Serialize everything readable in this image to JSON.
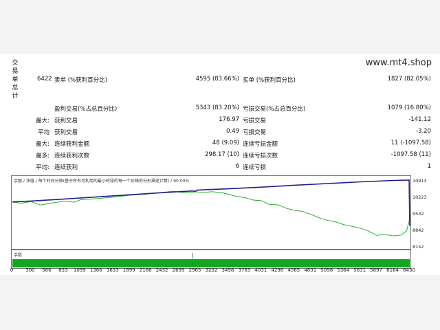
{
  "site": "www.mt4.shop",
  "side_label": [
    "交",
    "易",
    "单",
    "总",
    "计"
  ],
  "stats": {
    "total_trades": "6422",
    "short_label": "卖单 (%获利百分比)",
    "short_value": "4595 (83.66%)",
    "long_label": "买单 (%获利百分比)",
    "long_value": "1827 (82.05%)",
    "profit_trades_label": "盈利交易(%占总百分比)",
    "profit_trades_value": "5343 (83.20%)",
    "loss_trades_label": "亏损交易(%占总百分比)",
    "loss_trades_value": "1079 (16.80%)",
    "largest_prefix": "最大:",
    "largest_profit_label": "获利交易",
    "largest_profit_value": "176.97",
    "largest_loss_label": "亏损交易",
    "largest_loss_value": "-141.12",
    "average_prefix": "平均",
    "average_profit_label": "获利交易",
    "average_profit_value": "0.49",
    "average_loss_label": "亏损交易",
    "average_loss_value": "-3.20",
    "max_prefix": "最大:",
    "consec_wins_amount_label": "连续获利金额",
    "consec_wins_amount_value": "48 (9.09)",
    "consec_losses_amount_label": "连续亏损金额",
    "consec_losses_amount_value": "11 (-1097.58)",
    "most_prefix": "最多:",
    "consec_profit_count_label": "连续获利次数",
    "consec_profit_count_value": "298.17 (10)",
    "consec_loss_count_label": "连续亏损次数",
    "consec_loss_count_value": "-1097.58 (11)",
    "avg_prefix": "平均:",
    "avg_consec_wins_label": "连续获利",
    "avg_consec_wins_value": "6",
    "avg_consec_losses_label": "连续亏损",
    "avg_consec_losses_value": "1"
  },
  "chart_legend": "余额 / 净值 / 每个时间分格(基于所有可利用的最小时段的每一个价格的分形描述计算) / 90.00%",
  "volume_label": "手数",
  "colors": {
    "balance": "#1e1e8c",
    "equity": "#18a818",
    "volume": "#12a51f"
  },
  "chart_data": {
    "type": "line",
    "x_ticks": [
      "0",
      "300",
      "566",
      "833",
      "1099",
      "1366",
      "1633",
      "1899",
      "2166",
      "2432",
      "2699",
      "2965",
      "3232",
      "3498",
      "3765",
      "4031",
      "4298",
      "4565",
      "4831",
      "5098",
      "5364",
      "5631",
      "5897",
      "6164",
      "6430"
    ],
    "y_ticks": [
      "10913",
      "10223",
      "9532",
      "8842",
      "8152"
    ],
    "ylim": [
      8152,
      10913
    ],
    "xlim": [
      0,
      6430
    ],
    "series": [
      {
        "name": "余额",
        "x": [
          0,
          300,
          833,
          1366,
          1899,
          2432,
          2900,
          2965,
          3000,
          3498,
          4031,
          4565,
          5098,
          5631,
          6164,
          6420,
          6430
        ],
        "y": [
          10000,
          10040,
          10120,
          10210,
          10300,
          10390,
          10460,
          10450,
          10500,
          10550,
          10620,
          10700,
          10770,
          10840,
          10900,
          10913,
          9000
        ]
      },
      {
        "name": "净值",
        "x": [
          0,
          150,
          300,
          450,
          566,
          700,
          833,
          1000,
          1099,
          1366,
          1633,
          1899,
          2166,
          2432,
          2600,
          2800,
          2965,
          3100,
          3232,
          3400,
          3498,
          3600,
          3765,
          3900,
          4031,
          4150,
          4298,
          4450,
          4565,
          4700,
          4831,
          4950,
          5098,
          5250,
          5364,
          5500,
          5631,
          5750,
          5897,
          6000,
          6164,
          6300,
          6380,
          6430
        ],
        "y": [
          9990,
          9950,
          10020,
          9870,
          9920,
          9980,
          10030,
          9990,
          10090,
          10140,
          10200,
          10280,
          10330,
          10400,
          10450,
          10380,
          10420,
          10400,
          10430,
          10380,
          10320,
          10250,
          10180,
          10080,
          10050,
          9900,
          9880,
          9720,
          9650,
          9600,
          9480,
          9350,
          9230,
          9150,
          9050,
          8980,
          8900,
          8800,
          8600,
          8650,
          8580,
          8620,
          8800,
          9300
        ]
      }
    ]
  }
}
